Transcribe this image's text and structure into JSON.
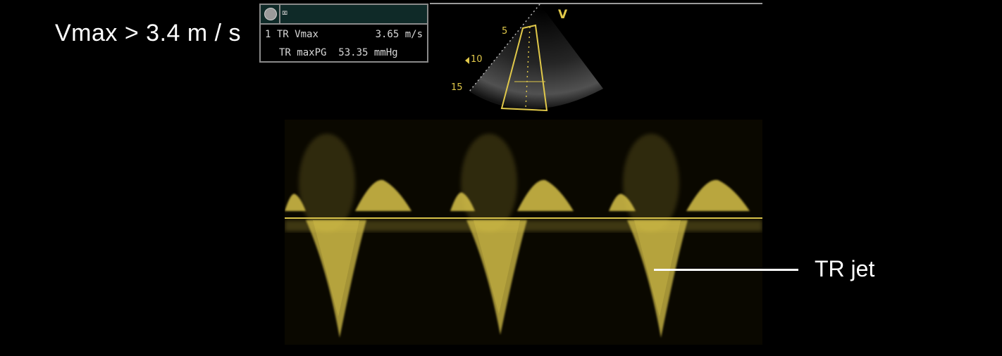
{
  "slide": {
    "title": "Vmax > 3.4 m / s"
  },
  "measurement_box": {
    "rows": [
      {
        "index": "1",
        "label": "TR Vmax",
        "value": "3.65 m/s"
      },
      {
        "index": "",
        "label": "TR maxPG",
        "value": "53.35 mmHg"
      }
    ],
    "cursor_glyph": "⌧"
  },
  "sector_view": {
    "mode_label": "V",
    "depth_marks": [
      "5",
      "10",
      "15"
    ]
  },
  "annotation": {
    "label": "TR jet"
  },
  "colors": {
    "doppler": "#d8c24a",
    "text": "#ffffff",
    "box_border": "#8a8a8a",
    "box_bar": "#0f2a28"
  }
}
